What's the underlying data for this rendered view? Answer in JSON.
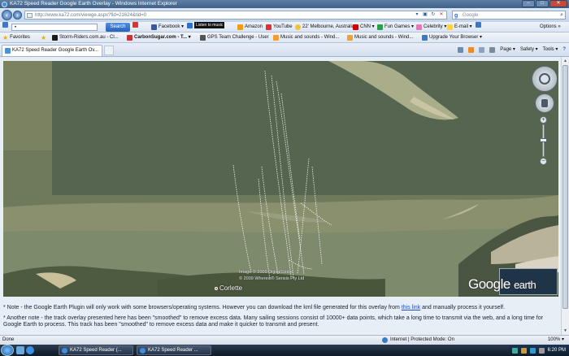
{
  "window": {
    "title": "KA72 Speed Reader Google Earth Overlay - Windows Internet Explorer",
    "buttons": [
      "–",
      "□",
      "✕"
    ]
  },
  "address": {
    "url": "http://www.ka72.com/viewge.aspx?fid=21624&tid=0",
    "search_placeholder": "Google"
  },
  "links_toolbar": {
    "search_value": "•",
    "search_button": "Search",
    "items": [
      "Facebook ▾",
      "Listen to music",
      "Amazon",
      "YouTube",
      "22' Melbourne, Australia",
      "CNN ▾",
      "Fun Games ▾",
      "Celebrity ▾",
      "E-mail ▾"
    ],
    "options": "Options »"
  },
  "favorites": {
    "label": "Favorites",
    "items": [
      "Storm-Riders.com.au - Cl...",
      "CarbonSugar.com - T... ▾",
      "GPS Team Challenge - User",
      "Music and sounds - Wind...",
      "Music and sounds - Wind...",
      "Upgrade Your Browser ▾"
    ]
  },
  "tab": {
    "label": "KA72 Speed Reader Google Earth Ov..."
  },
  "commands": [
    "Page ▾",
    "Safety ▾",
    "Tools ▾"
  ],
  "map": {
    "credit_lines": [
      "Image © 2009 DigitalGlobe",
      "© 2009 Whereis® Sensis Pty Ltd"
    ],
    "place": "Corlette",
    "logo_a": "Google",
    "logo_b": "earth"
  },
  "note": {
    "p1_before": "* Note - the Google Earth Plugin will only work with some browsers/operating systems. However you can download the kml file generated for this overlay from ",
    "p1_link": "this link",
    "p1_after": " and manually process it yourself.",
    "p2": "* Another note - the track overlay presented here has been \"smoothed\" to remove excess data. Many sailing sessions consist of 10000+ data points, which take a long time to transmit via the web, and a long time for Google Earth to process. This track has been \"smoothed\" to remove excess data and make it quicker to transmit and present."
  },
  "status": {
    "left": "Done",
    "zone": "Internet | Protected Mode: On",
    "zoom": "100% ▾"
  },
  "taskbar": {
    "buttons": [
      "KA72 Speed Reader (...",
      "KA72 Speed Reader ..."
    ],
    "clock": "6:20 PM"
  }
}
